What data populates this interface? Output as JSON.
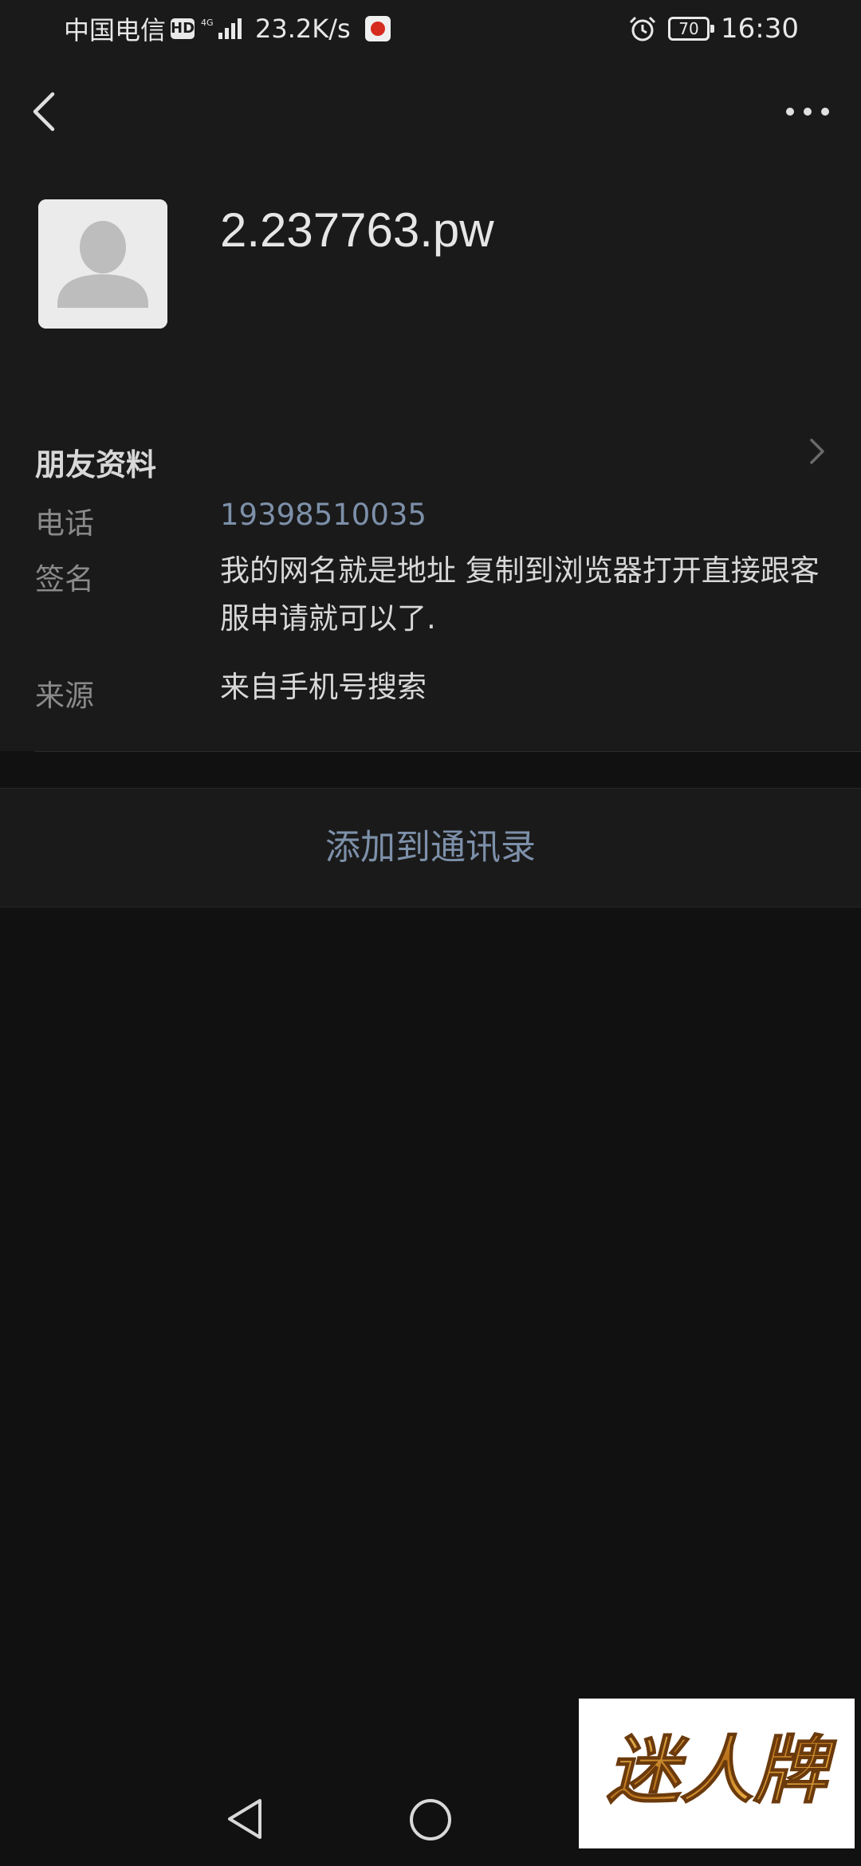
{
  "status_bar": {
    "carrier": "中国电信",
    "hd_badge": "HD",
    "net_speed": "23.2K/s",
    "battery": "70",
    "time": "16:30"
  },
  "nav": {
    "back_icon": "chevron-left-icon",
    "more_icon": "more-horizontal-icon"
  },
  "profile": {
    "nickname": "2.237763.pw",
    "avatar_icon": "default-avatar-icon"
  },
  "friend_info": {
    "title": "朋友资料",
    "rows": [
      {
        "label": "电话",
        "value": "19398510035"
      },
      {
        "label": "签名",
        "value": "我的网名就是地址 复制到浏览器打开直接跟客服申请就可以了."
      },
      {
        "label": "来源",
        "value": "来自手机号搜索"
      }
    ]
  },
  "actions": {
    "add_to_contacts": "添加到通讯录"
  },
  "watermark": {
    "text": "迷人牌"
  },
  "colors": {
    "background": "#111111",
    "card": "#1a1a1a",
    "link": "#7d90aa",
    "label": "#8a8a8a",
    "text": "#d8d8d8"
  }
}
